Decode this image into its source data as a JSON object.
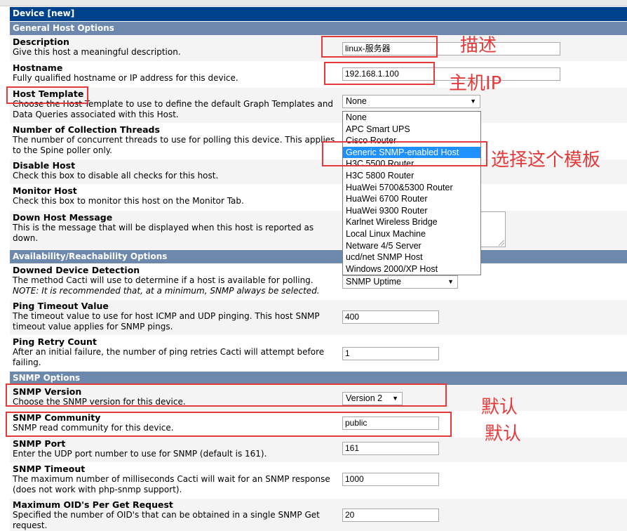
{
  "form": {
    "title": "Device [new]",
    "sections": {
      "general": "General Host Options",
      "availability": "Availability/Reachability Options",
      "snmp": "SNMP Options"
    },
    "description": {
      "label": "Description",
      "help": "Give this host a meaningful description.",
      "value": "linux-服务器"
    },
    "hostname": {
      "label": "Hostname",
      "help": "Fully qualified hostname or IP address for this device.",
      "value": "192.168.1.100"
    },
    "host_template": {
      "label": "Host Template",
      "help": "Choose the Host Template to use to define the default Graph Templates and Data Queries associated with this Host.",
      "selected": "None",
      "options": [
        "None",
        "APC Smart UPS",
        "Cisco Router",
        "Generic SNMP-enabled Host",
        "H3C 5500 Router",
        "H3C 5800 Router",
        "HuaWei 5700&5300 Router",
        "HuaWei 6700 Router",
        "HuaWei 9300 Router",
        "Karlnet Wireless Bridge",
        "Local Linux Machine",
        "Netware 4/5 Server",
        "ucd/net SNMP Host",
        "Windows 2000/XP Host"
      ],
      "highlighted": "Generic SNMP-enabled Host"
    },
    "threads": {
      "label": "Number of Collection Threads",
      "help": "The number of concurrent threads to use for polling this device. This applies to the Spine poller only."
    },
    "disable_host": {
      "label": "Disable Host",
      "help": "Check this box to disable all checks for this host."
    },
    "monitor_host": {
      "label": "Monitor Host",
      "help": "Check this box to monitor this host on the Monitor Tab."
    },
    "down_message": {
      "label": "Down Host Message",
      "help": "This is the message that will be displayed when this host is reported as down."
    },
    "downed_detection": {
      "label": "Downed Device Detection",
      "help": "The method Cacti will use to determine if a host is available for polling.",
      "note": "NOTE: It is recommended that, at a minimum, SNMP always be selected.",
      "value": "SNMP Uptime"
    },
    "ping_timeout": {
      "label": "Ping Timeout Value",
      "help": "The timeout value to use for host ICMP and UDP pinging. This host SNMP timeout value applies for SNMP pings.",
      "value": "400"
    },
    "ping_retry": {
      "label": "Ping Retry Count",
      "help": "After an initial failure, the number of ping retries Cacti will attempt before failing.",
      "value": "1"
    },
    "snmp_version": {
      "label": "SNMP Version",
      "help": "Choose the SNMP version for this device.",
      "value": "Version 2"
    },
    "snmp_community": {
      "label": "SNMP Community",
      "help": "SNMP read community for this device.",
      "value": "public"
    },
    "snmp_port": {
      "label": "SNMP Port",
      "help": "Enter the UDP port number to use for SNMP (default is 161).",
      "value": "161"
    },
    "snmp_timeout": {
      "label": "SNMP Timeout",
      "help": "The maximum number of milliseconds Cacti will wait for an SNMP response (does not work with php-snmp support).",
      "value": "1000"
    },
    "max_oids": {
      "label": "Maximum OID's Per Get Request",
      "help": "Specified the number of OID's that can be obtained in a single SNMP Get request.",
      "value": "20"
    }
  },
  "annotations": {
    "description": "描述",
    "hostname": "主机IP",
    "template": "选择这个模板",
    "default1": "默认",
    "default2": "默认",
    "color": "#e53a3a"
  }
}
